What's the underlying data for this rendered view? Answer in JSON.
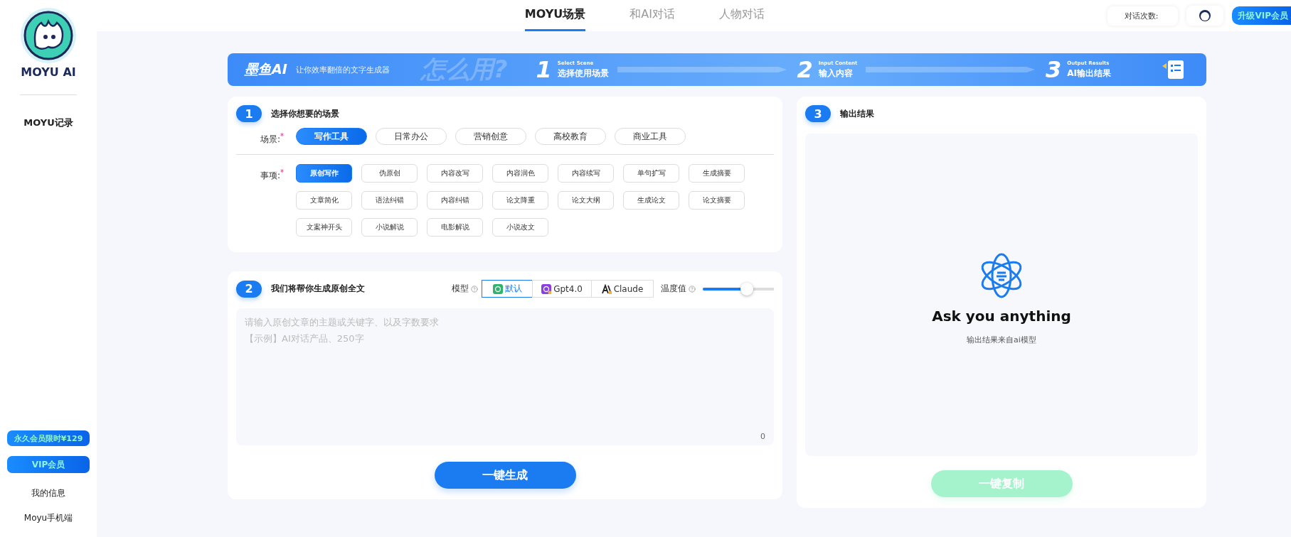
{
  "sidebar": {
    "brand": "MOYU AI",
    "nav": [
      {
        "label": "MOYU记录"
      }
    ],
    "promo": "永久会员限时¥129",
    "vip": "VIP会员",
    "links": [
      {
        "label": "我的信息"
      },
      {
        "label": "Moyu手机端"
      }
    ]
  },
  "header": {
    "tabs": [
      {
        "label": "MOYU场景",
        "selected": true
      },
      {
        "label": "和AI对话",
        "selected": false
      },
      {
        "label": "人物对话",
        "selected": false
      }
    ],
    "count_label": "对话次数:",
    "upgrade": "升级VIP会员"
  },
  "banner": {
    "brand": "墨鱼AI",
    "tagline": "让你效率翻倍的文字生成器",
    "howto": "怎么用?",
    "steps": [
      {
        "number": "1",
        "en": "Select Scene",
        "zh": "选择使用场景"
      },
      {
        "number": "2",
        "en": "Input Content",
        "zh": "输入内容"
      },
      {
        "number": "3",
        "en": "Output Results",
        "zh": "AI输出结果"
      }
    ]
  },
  "scene_panel": {
    "number": "1",
    "title": "选择你想要的场景",
    "scene_label": "场景:",
    "required_mark": "*",
    "scenes": [
      {
        "label": "写作工具",
        "selected": true
      },
      {
        "label": "日常办公",
        "selected": false
      },
      {
        "label": "营销创意",
        "selected": false
      },
      {
        "label": "高校教育",
        "selected": false
      },
      {
        "label": "商业工具",
        "selected": false
      }
    ],
    "item_label": "事项:",
    "items": [
      {
        "label": "原创写作",
        "selected": true
      },
      {
        "label": "伪原创",
        "selected": false
      },
      {
        "label": "内容改写",
        "selected": false
      },
      {
        "label": "内容润色",
        "selected": false
      },
      {
        "label": "内容续写",
        "selected": false
      },
      {
        "label": "单句扩写",
        "selected": false
      },
      {
        "label": "生成摘要",
        "selected": false
      },
      {
        "label": "文章简化",
        "selected": false
      },
      {
        "label": "语法纠错",
        "selected": false
      },
      {
        "label": "内容纠错",
        "selected": false
      },
      {
        "label": "论文降重",
        "selected": false
      },
      {
        "label": "论文大纲",
        "selected": false
      },
      {
        "label": "生成论文",
        "selected": false
      },
      {
        "label": "论文摘要",
        "selected": false
      },
      {
        "label": "文案神开头",
        "selected": false
      },
      {
        "label": "小说解说",
        "selected": false
      },
      {
        "label": "电影解说",
        "selected": false
      },
      {
        "label": "小说改文",
        "selected": false
      }
    ]
  },
  "input_panel": {
    "number": "2",
    "title": "我们将帮你生成原创全文",
    "model_label": "模型",
    "models": [
      {
        "label": "默认",
        "kind": "default",
        "selected": true
      },
      {
        "label": "Gpt4.0",
        "kind": "gpt",
        "selected": false
      },
      {
        "label": "Claude",
        "kind": "claude",
        "selected": false
      }
    ],
    "temperature_label": "温度值",
    "temperature": {
      "level": 0.62
    },
    "placeholder": [
      "请输入原创文章的主题或关键字、以及字数要求",
      "【示例】AI对话产品、250字"
    ],
    "char_count": "0",
    "generate": "一键生成"
  },
  "output_panel": {
    "number": "3",
    "title": "输出结果",
    "heading": "Ask you anything",
    "subtitle": "输出结果来自ai模型",
    "copy": {
      "label": "一键复制",
      "disabled": true
    }
  }
}
